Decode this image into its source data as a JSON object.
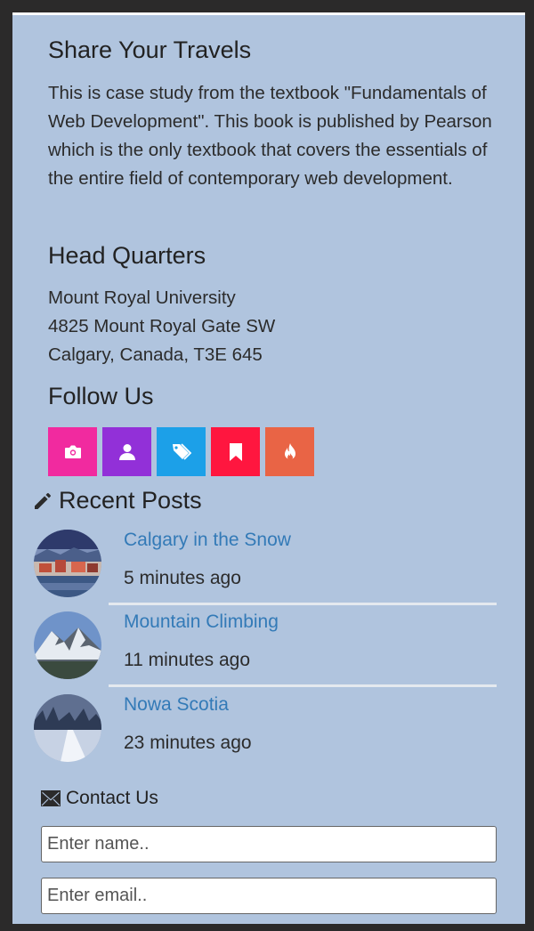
{
  "share": {
    "title": "Share Your Travels",
    "text": "This is case study from the textbook \"Fundamentals of Web Development\". This book is published by Pearson which is the only textbook that covers the essentials of the entire field of contemporary web development."
  },
  "headquarters": {
    "title": "Head Quarters",
    "lines": [
      "Mount Royal University",
      "4825 Mount Royal Gate SW",
      "Calgary, Canada, T3E 645"
    ]
  },
  "follow": {
    "title": "Follow Us",
    "buttons": [
      {
        "icon": "camera-icon",
        "color": "#f12a9f"
      },
      {
        "icon": "user-icon",
        "color": "#9230d8"
      },
      {
        "icon": "tags-icon",
        "color": "#1ca0e8"
      },
      {
        "icon": "bookmark-icon",
        "color": "#ff163f"
      },
      {
        "icon": "fire-icon",
        "color": "#e96445"
      }
    ]
  },
  "recent": {
    "title": "Recent Posts",
    "icon": "pencil-icon",
    "posts": [
      {
        "title": "Calgary in the Snow",
        "time": "5 minutes ago"
      },
      {
        "title": "Mountain Climbing",
        "time": "11 minutes ago"
      },
      {
        "title": "Nowa Scotia",
        "time": "23 minutes ago"
      }
    ]
  },
  "contact": {
    "title": "Contact Us",
    "icon": "envelope-icon",
    "name_placeholder": "Enter name..",
    "email_placeholder": "Enter email.."
  }
}
